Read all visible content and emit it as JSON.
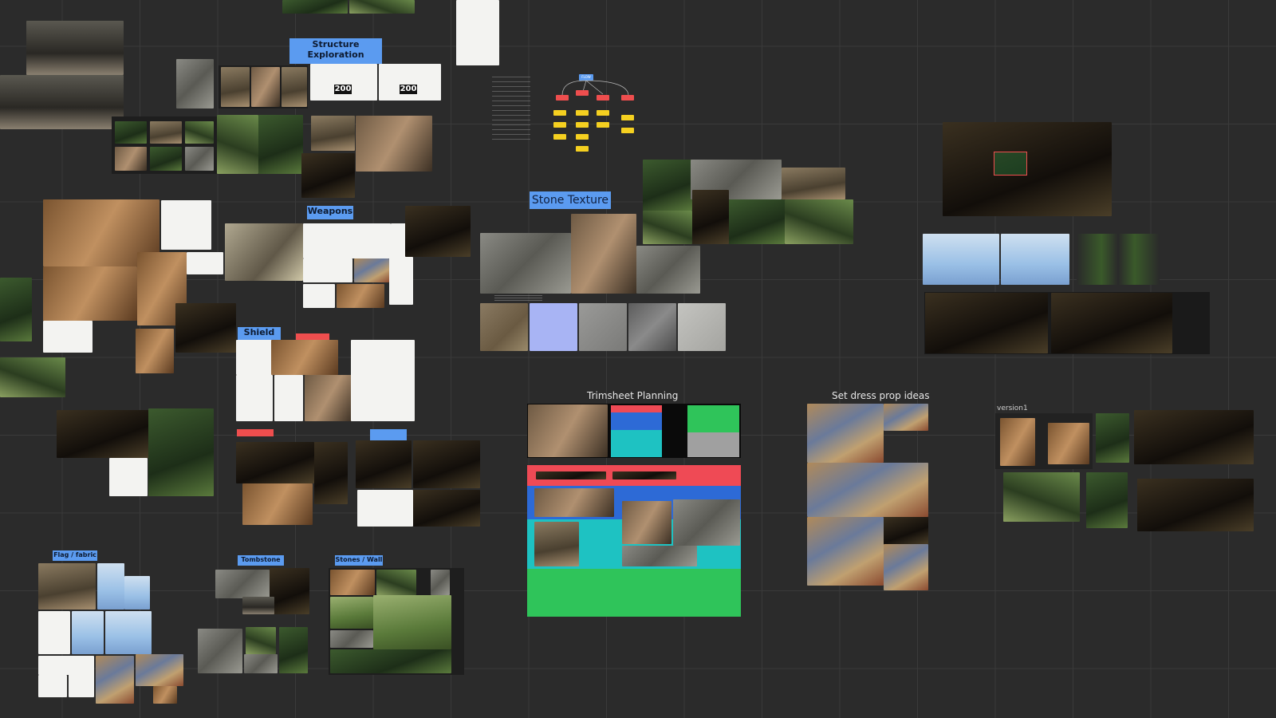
{
  "board": {
    "labels": {
      "structure_exploration": "Structure Exploration",
      "weapons": "Weapons",
      "shield": "Shield",
      "flag_fabric": "Flag / fabric",
      "tombstone": "Tombstone",
      "stones_wall": "Stones / Wall",
      "stone_texture": "Stone Texture",
      "trimsheet_planning": "Trimsheet Planning",
      "set_dress_prop_ideas": "Set dress prop ideas",
      "version1": "version1",
      "count_200_a": "200",
      "count_200_b": "200",
      "flow": "FLOW"
    },
    "colors": {
      "background": "#2b2b2b",
      "grid": "#3a3a3a",
      "label_blue": "#5b9bf0",
      "label_red": "#ee4e4e",
      "trim_red": "#ef4a55",
      "trim_blue": "#2d6ad6",
      "trim_cyan": "#1ec2c2",
      "trim_green": "#2fc45a",
      "flow_yellow": "#f5d020"
    },
    "texture_swatches": [
      "#7a6a52",
      "#a8b4f4",
      "#8a8a88",
      "#6c6c6c",
      "#b4b4b0"
    ]
  }
}
